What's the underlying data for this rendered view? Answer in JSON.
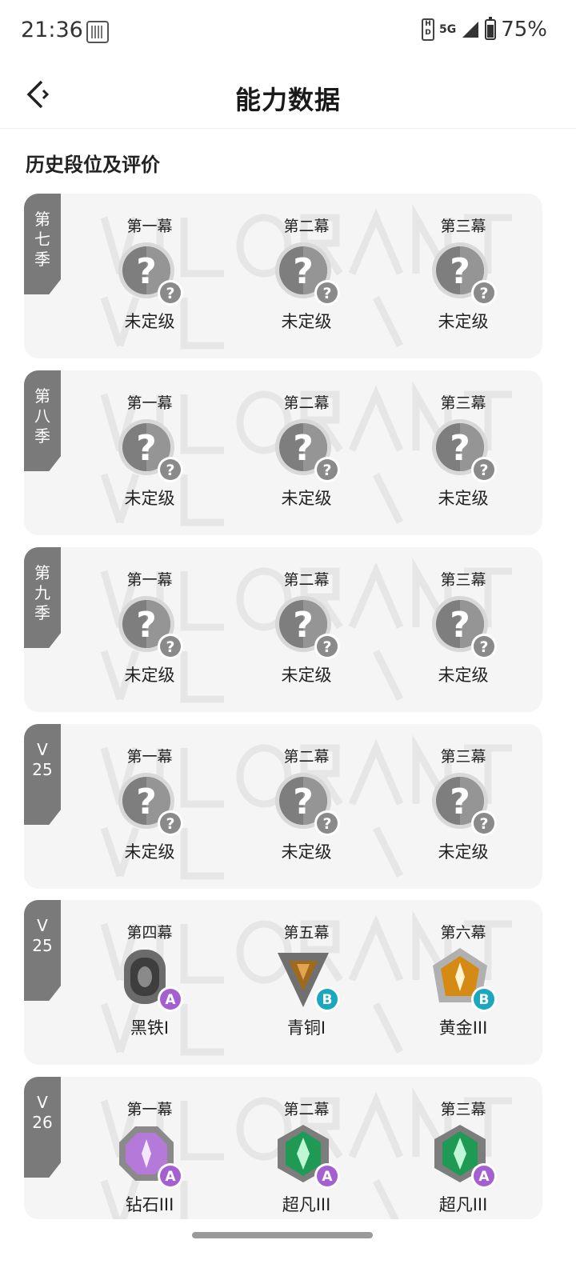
{
  "status_bar": {
    "time": "21:36",
    "network": "5G",
    "battery": "75%"
  },
  "header": {
    "title": "能力数据"
  },
  "section_title": "历史段位及评价",
  "seasons": [
    {
      "tag": [
        "第",
        "七",
        "季"
      ],
      "acts": [
        {
          "act": "第一幕",
          "rank": "未定级",
          "badge": "unranked",
          "grade": "?"
        },
        {
          "act": "第二幕",
          "rank": "未定级",
          "badge": "unranked",
          "grade": "?"
        },
        {
          "act": "第三幕",
          "rank": "未定级",
          "badge": "unranked",
          "grade": "?"
        }
      ]
    },
    {
      "tag": [
        "第",
        "八",
        "季"
      ],
      "acts": [
        {
          "act": "第一幕",
          "rank": "未定级",
          "badge": "unranked",
          "grade": "?"
        },
        {
          "act": "第二幕",
          "rank": "未定级",
          "badge": "unranked",
          "grade": "?"
        },
        {
          "act": "第三幕",
          "rank": "未定级",
          "badge": "unranked",
          "grade": "?"
        }
      ]
    },
    {
      "tag": [
        "第",
        "九",
        "季"
      ],
      "acts": [
        {
          "act": "第一幕",
          "rank": "未定级",
          "badge": "unranked",
          "grade": "?"
        },
        {
          "act": "第二幕",
          "rank": "未定级",
          "badge": "unranked",
          "grade": "?"
        },
        {
          "act": "第三幕",
          "rank": "未定级",
          "badge": "unranked",
          "grade": "?"
        }
      ]
    },
    {
      "tag": [
        "V",
        "25"
      ],
      "acts": [
        {
          "act": "第一幕",
          "rank": "未定级",
          "badge": "unranked",
          "grade": "?"
        },
        {
          "act": "第二幕",
          "rank": "未定级",
          "badge": "unranked",
          "grade": "?"
        },
        {
          "act": "第三幕",
          "rank": "未定级",
          "badge": "unranked",
          "grade": "?"
        }
      ]
    },
    {
      "tag": [
        "V",
        "25"
      ],
      "acts": [
        {
          "act": "第四幕",
          "rank": "黑铁I",
          "badge": "iron",
          "grade": "A"
        },
        {
          "act": "第五幕",
          "rank": "青铜I",
          "badge": "bronze",
          "grade": "B"
        },
        {
          "act": "第六幕",
          "rank": "黄金III",
          "badge": "gold",
          "grade": "B"
        }
      ]
    },
    {
      "tag": [
        "V",
        "26"
      ],
      "acts": [
        {
          "act": "第一幕",
          "rank": "钻石III",
          "badge": "diamond",
          "grade": "A"
        },
        {
          "act": "第二幕",
          "rank": "超凡III",
          "badge": "ascendant",
          "grade": "A"
        },
        {
          "act": "第三幕",
          "rank": "超凡III",
          "badge": "ascendant",
          "grade": "A"
        }
      ]
    }
  ],
  "colors": {
    "grade_A": "#a45fd0",
    "grade_B": "#1ba7bd",
    "tag_bg": "#7a7a7a",
    "card_bg": "#f5f5f5"
  }
}
